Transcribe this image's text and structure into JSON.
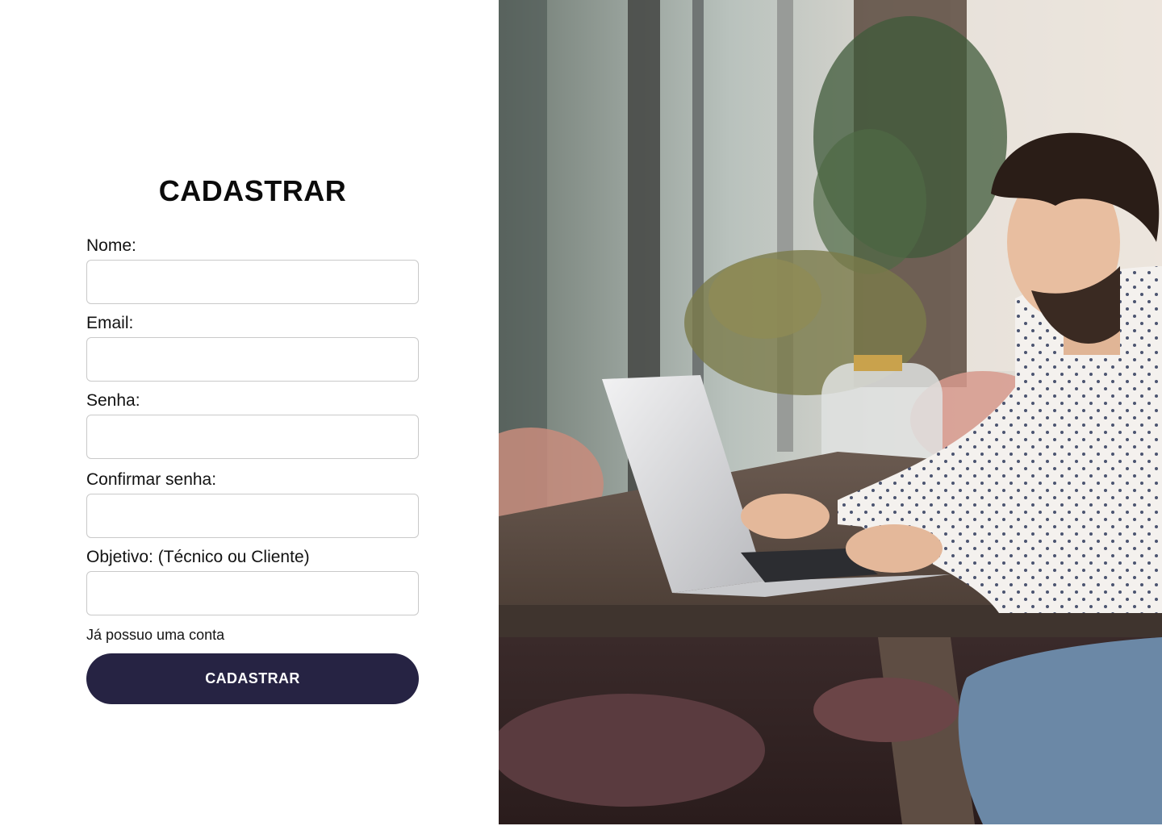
{
  "form": {
    "title": "CADASTRAR",
    "fields": [
      {
        "label": "Nome:",
        "value": "",
        "placeholder": ""
      },
      {
        "label": "Email:",
        "value": "",
        "placeholder": ""
      },
      {
        "label": "Senha:",
        "value": "",
        "placeholder": ""
      },
      {
        "label": "Confirmar senha:",
        "value": "",
        "placeholder": ""
      },
      {
        "label": "Objetivo: (Técnico ou Cliente)",
        "value": "",
        "placeholder": ""
      }
    ],
    "login_link": "Já possuo uma conta",
    "submit_label": "CADASTRAR"
  },
  "colors": {
    "primary": "#262343",
    "input_border": "#c9c9c9",
    "background": "#ffffff"
  }
}
